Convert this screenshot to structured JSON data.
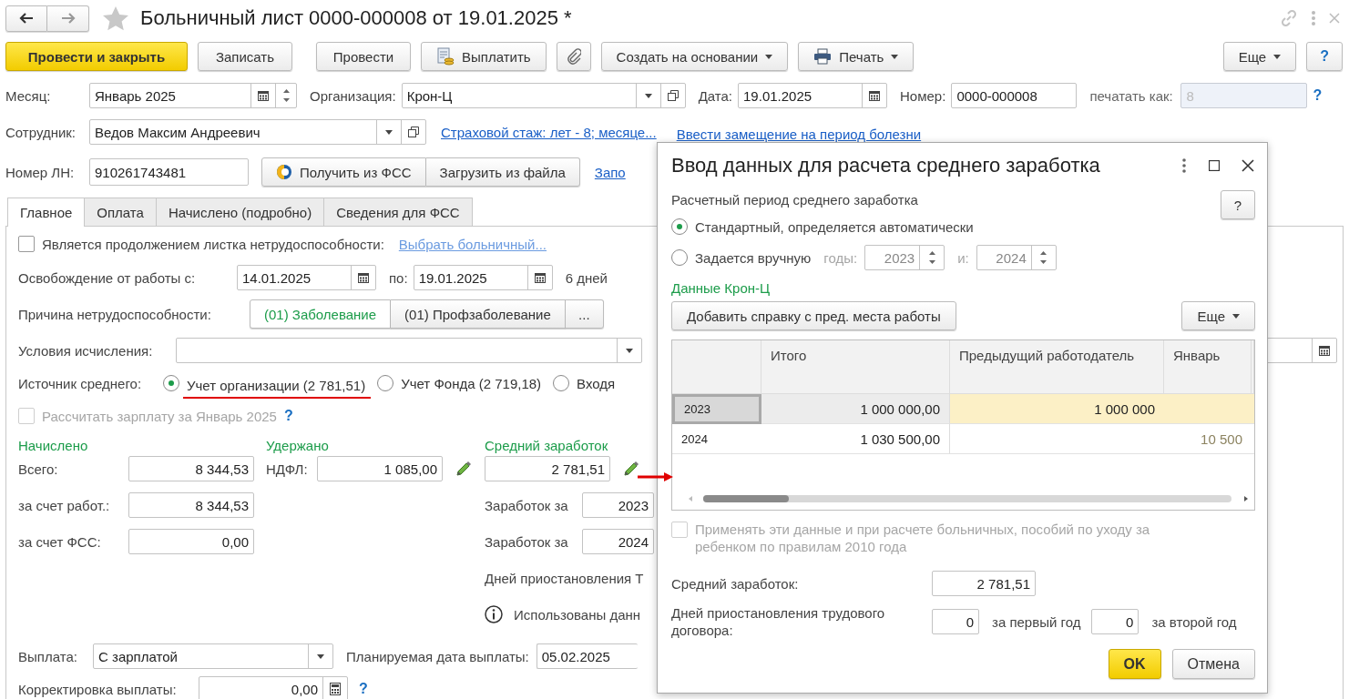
{
  "window": {
    "title": "Больничный лист 0000-000008 от 19.01.2025 *",
    "favorite": false
  },
  "toolbar": {
    "left": [
      {
        "kind": "primary",
        "label": "Провести и закрыть"
      },
      {
        "kind": "plain",
        "label": "Записать"
      },
      {
        "kind": "plain",
        "label": "Провести"
      },
      {
        "kind": "pay",
        "label": "Выплатить"
      },
      {
        "kind": "attach"
      },
      {
        "kind": "dropdown",
        "label": "Создать на основании"
      },
      {
        "kind": "print",
        "label": "Печать"
      }
    ],
    "right": [
      {
        "kind": "dropdown",
        "label": "Еще"
      },
      {
        "kind": "help",
        "label": "?"
      }
    ]
  },
  "header": {
    "month": {
      "label": "Месяц:",
      "value": "Январь 2025"
    },
    "organization": {
      "label": "Организация:",
      "value": "Крон-Ц"
    },
    "date": {
      "label": "Дата:",
      "value": "19.01.2025"
    },
    "number": {
      "label": "Номер:",
      "value": "0000-000008"
    },
    "print_as": {
      "label": "печатать как:",
      "placeholder": "8",
      "disabled": true
    },
    "print_as_help": "?",
    "employee": {
      "label": "Сотрудник:",
      "value": "Ведов Максим Андреевич"
    },
    "insurance_link": "Страховой стаж: лет - 8; месяце...",
    "substitute_link": "Ввести замещение на период болезни",
    "ln_number": {
      "label": "Номер ЛН:",
      "value": "910261743481"
    },
    "fss_buttons": [
      {
        "kind": "fss",
        "label": "Получить из ФСС"
      },
      {
        "kind": "plain",
        "label": "Загрузить из файла"
      }
    ],
    "fill_link": "Запо"
  },
  "tabs": [
    {
      "label": "Главное",
      "selected": true
    },
    {
      "label": "Оплата",
      "selected": false
    },
    {
      "label": "Начислено (подробно)",
      "selected": false
    },
    {
      "label": "Сведения для ФСС",
      "selected": false
    }
  ],
  "main": {
    "continuation": {
      "label": "Является продолжением листка нетрудоспособности:",
      "checked": false
    },
    "choose_link": "Выбрать больничный...",
    "release": {
      "label": "Освобождение от работы с:",
      "from": "14.01.2025",
      "to_label": "по:",
      "to": "19.01.2025",
      "days": "6 дней"
    },
    "reason": {
      "label": "Причина нетрудоспособности:",
      "options": [
        {
          "label": "(01) Заболевание",
          "selected": true
        },
        {
          "label": "(01) Профзаболевание",
          "selected": false
        }
      ],
      "more": "..."
    },
    "conditions": {
      "label": "Условия исчисления:"
    },
    "source": {
      "label": "Источник среднего:",
      "options": [
        {
          "label": "Учет организации (2 781,51)",
          "selected": true,
          "highlighted": true
        },
        {
          "label": "Учет Фонда (2 719,18)",
          "selected": false,
          "highlighted": false
        },
        {
          "label": "Входя",
          "selected": false,
          "highlighted": false
        }
      ]
    },
    "recalc": {
      "label": "Рассчитать зарплату за Январь 2025",
      "checked": false,
      "disabled": true
    },
    "recalc_help": "?",
    "accrued": {
      "title": "Начислено",
      "rows": [
        {
          "label": "Всего:",
          "value": "8 344,53"
        },
        {
          "label": "за счет работ.:",
          "value": "8 344,53"
        },
        {
          "label": "за счет ФСС:",
          "value": "0,00"
        }
      ]
    },
    "withheld": {
      "title": "Удержано",
      "rows": [
        {
          "label": "НДФЛ:",
          "value": "1 085,00"
        }
      ]
    },
    "average": {
      "title": "Средний заработок",
      "value": "2 781,51",
      "years": [
        {
          "label": "Заработок за",
          "value": "2023"
        },
        {
          "label": "Заработок за",
          "value": "2024"
        }
      ],
      "suspension": "Дней приостановления Т",
      "info": "Использованы данн"
    },
    "payment": {
      "label": "Выплата:",
      "value": "С зарплатой",
      "planned_label": "Планируемая дата выплаты:",
      "planned": "05.02.2025"
    },
    "correction": {
      "label": "Корректировка выплаты:",
      "value": "0,00"
    },
    "correction_help": "?"
  },
  "dialog": {
    "title": "Ввод данных для расчета среднего заработка",
    "period_label": "Расчетный период среднего заработка",
    "help": "?",
    "period_options": [
      {
        "label": "Стандартный, определяется автоматически",
        "selected": true
      },
      {
        "label": "Задается вручную",
        "selected": false
      }
    ],
    "years_label": "годы:",
    "year1": "2023",
    "and_label": "и:",
    "year2": "2024",
    "years_disabled": true,
    "section": "Данные Крон-Ц",
    "add_button": "Добавить справку с пред. места работы",
    "more_button": "Еще",
    "columns": [
      "Итого",
      "Предыдущий работодатель",
      "Январь"
    ],
    "rows": [
      {
        "year": "2023",
        "total": "1 000 000,00",
        "previous": "1 000 000",
        "selected": true
      },
      {
        "year": "2024",
        "total": "1 030 500,00",
        "january": "10 500",
        "selected": false
      }
    ],
    "apply": {
      "label": "Применять эти данные и при расчете больничных, пособий по уходу за ребенком по правилам 2010 года",
      "checked": false,
      "disabled": true
    },
    "average": {
      "label": "Средний заработок:",
      "value": "2 781,51"
    },
    "suspension": {
      "label": "Дней приостановления трудового договора:",
      "first": "0",
      "first_label": "за первый год",
      "second": "0",
      "second_label": "за второй год"
    },
    "buttons": [
      {
        "kind": "primary",
        "label": "OK"
      },
      {
        "kind": "plain",
        "label": "Отмена"
      }
    ]
  }
}
